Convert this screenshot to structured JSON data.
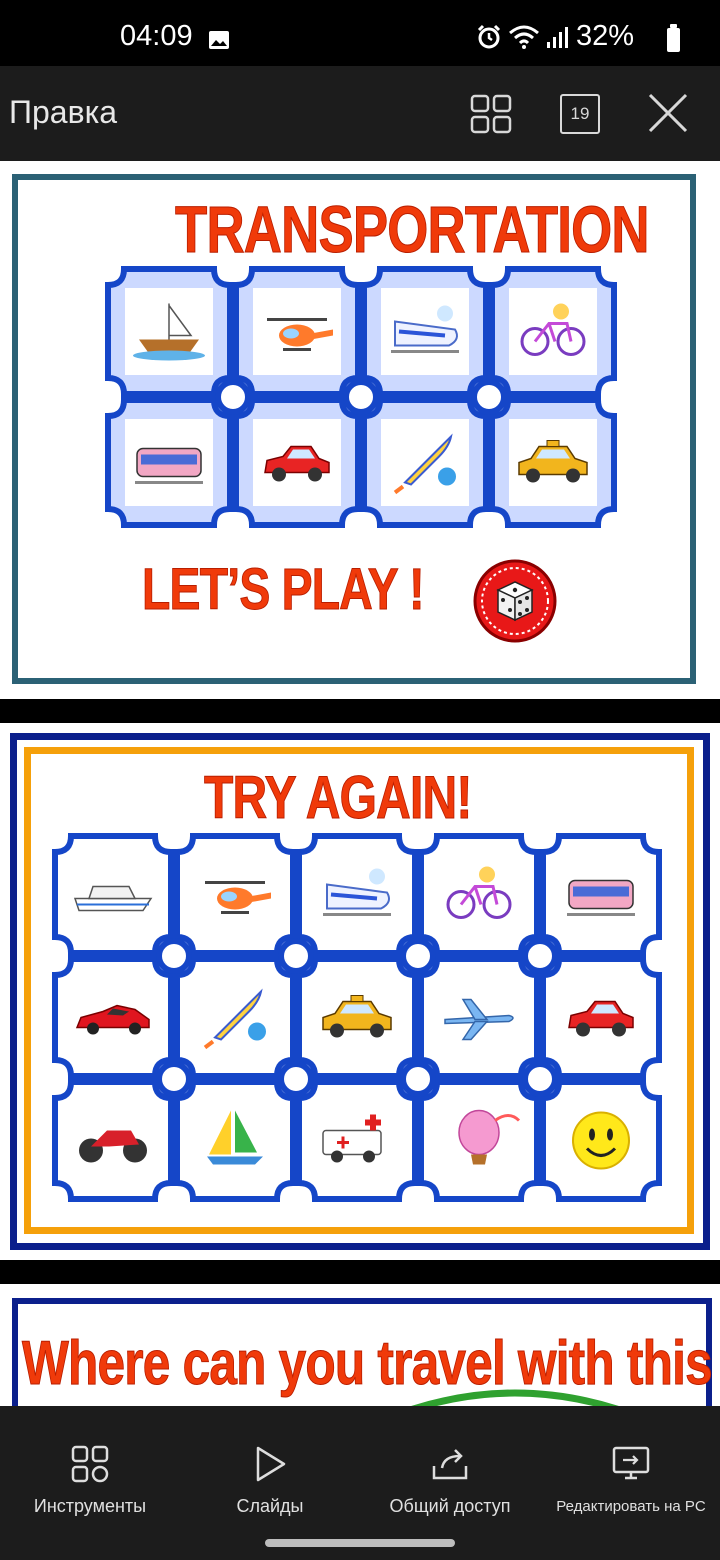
{
  "status_bar": {
    "time": "04:09",
    "battery": "32%",
    "icons": [
      "image-icon",
      "alarm-icon",
      "wifi-icon",
      "signal-icon",
      "battery-icon"
    ]
  },
  "app_bar": {
    "title": "Правка",
    "slide_count": "19",
    "buttons": [
      "grid-icon",
      "slide-count",
      "close-icon"
    ]
  },
  "slides": [
    {
      "title": "TRANSPORTATION",
      "subtitle": "LET’S PLAY !",
      "frame_color": "#2b6175",
      "tiles": [
        "boat",
        "helicopter",
        "train",
        "bicycle",
        "tram",
        "car",
        "rocket",
        "taxi"
      ]
    },
    {
      "title": "TRY AGAIN!",
      "frame_colors": {
        "outer": "#0b1f8c",
        "inner": "#f5a00a"
      },
      "tiles": [
        "ship",
        "helicopter",
        "train",
        "bicycle",
        "tram",
        "sports-car",
        "rocket",
        "taxi",
        "airplane",
        "red-car",
        "motorcycle",
        "sailboat",
        "ambulance",
        "hot-air-balloon",
        "smiley"
      ]
    },
    {
      "title": "Where can you travel with this machine?"
    }
  ],
  "bottom_nav": {
    "items": [
      {
        "label": "Инструменты",
        "icon": "tools-icon"
      },
      {
        "label": "Слайды",
        "icon": "play-icon"
      },
      {
        "label": "Общий доступ",
        "icon": "share-icon"
      },
      {
        "label": "Редактировать на PC",
        "icon": "edit-on-pc-icon"
      }
    ]
  },
  "colors": {
    "title_red": "#f03a0a",
    "tile_blue": "#1546c8",
    "tile_fill": "#ccd9ff"
  }
}
